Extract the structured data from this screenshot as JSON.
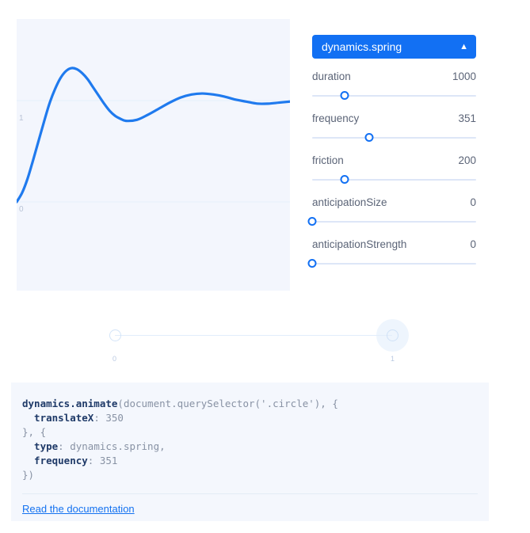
{
  "graph": {
    "y_axis_labels": {
      "top": "1",
      "bottom": "0"
    },
    "curve_color": "#1f7aee",
    "panel_background": "#f3f6fd",
    "gridline_color": "#e4eefb"
  },
  "chart_data": {
    "type": "line",
    "title": "",
    "xlabel": "",
    "ylabel": "",
    "xlim": [
      0,
      1
    ],
    "ylim": [
      0,
      1.45
    ],
    "grid": true,
    "gridlines_y": [
      0,
      1
    ],
    "tick_labels_y": [
      "0",
      "1"
    ],
    "legend": null,
    "series": [
      {
        "name": "dynamics.spring",
        "color": "#1f7aee",
        "x": [
          0.0,
          0.02,
          0.04,
          0.06,
          0.08,
          0.1,
          0.12,
          0.14,
          0.16,
          0.18,
          0.2,
          0.22,
          0.24,
          0.26,
          0.28,
          0.3,
          0.32,
          0.34,
          0.36,
          0.38,
          0.4,
          0.44,
          0.48,
          0.52,
          0.56,
          0.6,
          0.64,
          0.68,
          0.72,
          0.76,
          0.8,
          0.84,
          0.88,
          0.92,
          0.96,
          1.0
        ],
        "y": [
          0.0,
          0.09,
          0.23,
          0.41,
          0.6,
          0.79,
          0.97,
          1.11,
          1.22,
          1.29,
          1.32,
          1.31,
          1.27,
          1.21,
          1.13,
          1.05,
          0.97,
          0.9,
          0.85,
          0.82,
          0.8,
          0.81,
          0.86,
          0.92,
          0.98,
          1.03,
          1.06,
          1.07,
          1.06,
          1.04,
          1.01,
          0.99,
          0.97,
          0.97,
          0.98,
          0.99
        ]
      }
    ]
  },
  "controls": {
    "type_select": {
      "value": "dynamics.spring",
      "caret_icon": "chevron-up-down-icon",
      "background": "#1270f3",
      "text_color": "#ffffff"
    },
    "parameters": [
      {
        "name": "duration",
        "value": "1000",
        "percent": 20
      },
      {
        "name": "frequency",
        "value": "351",
        "percent": 35
      },
      {
        "name": "friction",
        "value": "200",
        "percent": 20
      },
      {
        "name": "anticipationSize",
        "value": "0",
        "percent": 0
      },
      {
        "name": "anticipationStrength",
        "value": "0",
        "percent": 0
      }
    ]
  },
  "preview": {
    "start_label": "0",
    "end_label": "1",
    "start_circle": "preview-start-circle",
    "end_circle": "preview-end-circle"
  },
  "code": {
    "lines": [
      [
        {
          "t": "dynamics.animate",
          "c": "k"
        },
        {
          "t": "(document.querySelector('.circle'), {",
          "c": "p"
        }
      ],
      [
        {
          "t": "  translateX",
          "c": "k"
        },
        {
          "t": ": ",
          "c": "p"
        },
        {
          "t": "350",
          "c": "v"
        }
      ],
      [
        {
          "t": "}, {",
          "c": "p"
        }
      ],
      [
        {
          "t": "  type",
          "c": "k"
        },
        {
          "t": ": ",
          "c": "p"
        },
        {
          "t": "dynamics.spring,",
          "c": "v"
        }
      ],
      [
        {
          "t": "  frequency",
          "c": "k"
        },
        {
          "t": ": ",
          "c": "p"
        },
        {
          "t": "351",
          "c": "v"
        }
      ],
      [
        {
          "t": "})",
          "c": "p"
        }
      ]
    ],
    "doc_link": "Read the documentation"
  }
}
